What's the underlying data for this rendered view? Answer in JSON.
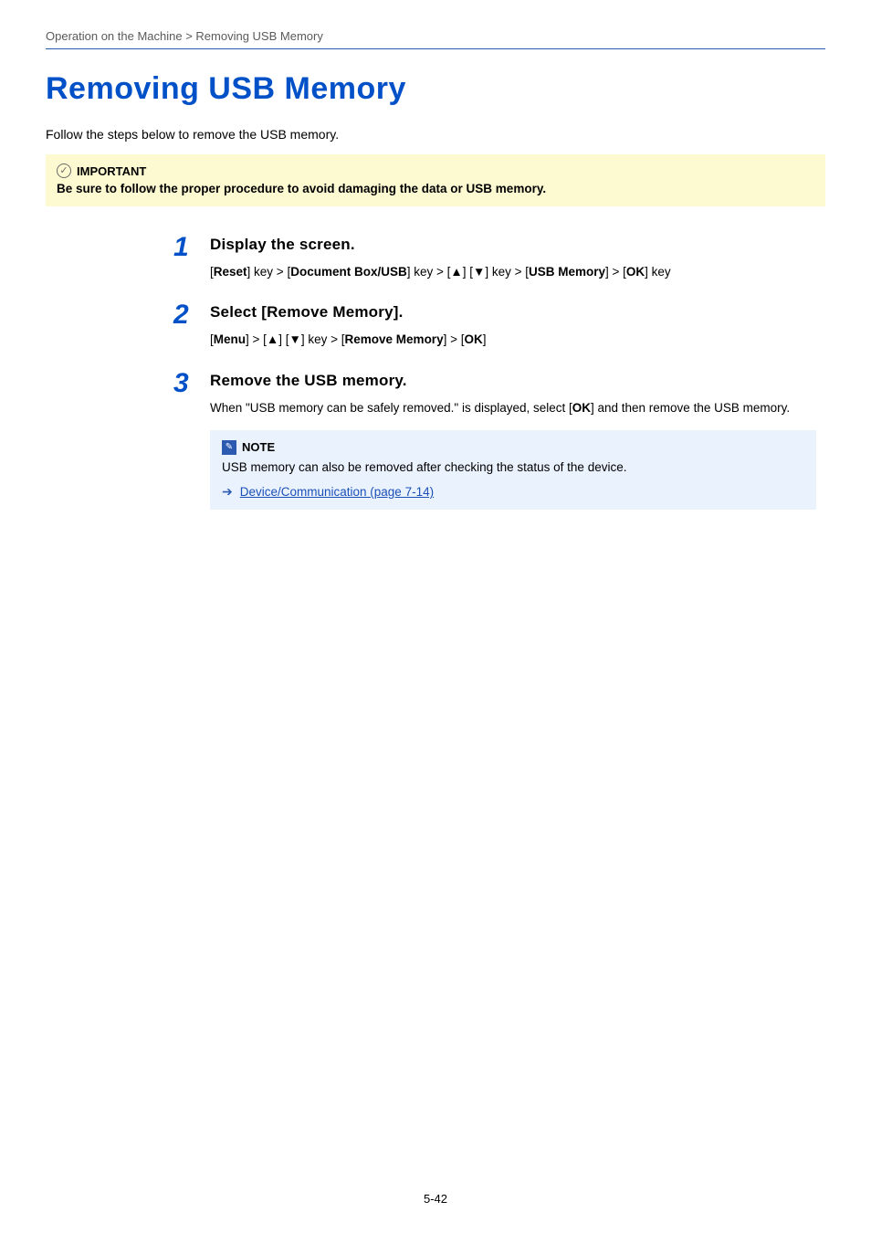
{
  "breadcrumb": "Operation on the Machine > Removing USB Memory",
  "title": "Removing USB Memory",
  "intro": "Follow the steps below to remove the USB memory.",
  "important": {
    "label": "IMPORTANT",
    "text": "Be sure to follow the proper procedure to avoid damaging the data or USB memory."
  },
  "steps": [
    {
      "num": "1",
      "title": "Display the screen.",
      "segments": [
        {
          "t": "[",
          "b": false
        },
        {
          "t": "Reset",
          "b": true
        },
        {
          "t": "] key > [",
          "b": false
        },
        {
          "t": "Document Box/USB",
          "b": true
        },
        {
          "t": "] key > [▲] [▼] key > [",
          "b": false
        },
        {
          "t": "USB Memory",
          "b": true
        },
        {
          "t": "] > [",
          "b": false
        },
        {
          "t": "OK",
          "b": true
        },
        {
          "t": "] key",
          "b": false
        }
      ]
    },
    {
      "num": "2",
      "title": "Select [Remove Memory].",
      "segments": [
        {
          "t": "[",
          "b": false
        },
        {
          "t": "Menu",
          "b": true
        },
        {
          "t": "] > [▲] [▼] key > [",
          "b": false
        },
        {
          "t": "Remove Memory",
          "b": true
        },
        {
          "t": "] > [",
          "b": false
        },
        {
          "t": "OK",
          "b": true
        },
        {
          "t": "]",
          "b": false
        }
      ]
    },
    {
      "num": "3",
      "title": "Remove the USB memory.",
      "segments": [
        {
          "t": "When \"USB memory can be safely removed.\" is displayed, select [",
          "b": false
        },
        {
          "t": "OK",
          "b": true
        },
        {
          "t": "] and then remove the USB memory.",
          "b": false
        }
      ],
      "note": {
        "label": "NOTE",
        "text": "USB memory can also be removed after checking the status of the device.",
        "xref": "Device/Communication (page 7-14)"
      }
    }
  ],
  "pageNumber": "5-42"
}
